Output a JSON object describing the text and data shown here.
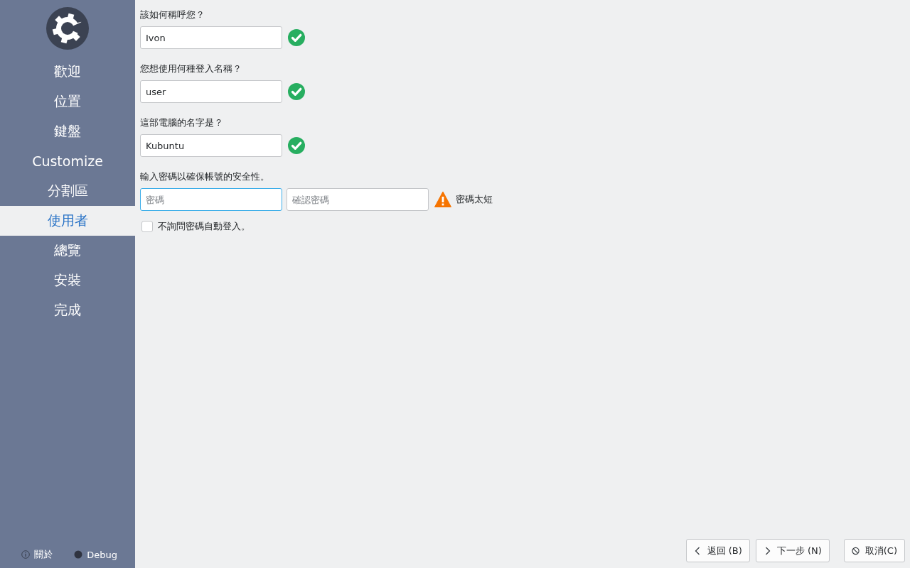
{
  "sidebar": {
    "items": [
      {
        "label": "歡迎",
        "selected": false
      },
      {
        "label": "位置",
        "selected": false
      },
      {
        "label": "鍵盤",
        "selected": false
      },
      {
        "label": "Customize",
        "selected": false
      },
      {
        "label": "分割區",
        "selected": false
      },
      {
        "label": "使用者",
        "selected": true
      },
      {
        "label": "總覽",
        "selected": false
      },
      {
        "label": "安裝",
        "selected": false
      },
      {
        "label": "完成",
        "selected": false
      }
    ],
    "footer": [
      {
        "label": "關於",
        "kind": "info"
      },
      {
        "label": "Debug",
        "kind": "dot"
      }
    ]
  },
  "fields": [
    {
      "label": "該如何稱呼您？",
      "value": "Ivon",
      "valid": true
    },
    {
      "label": "您想使用何種登入名稱？",
      "value": "user",
      "valid": true
    },
    {
      "label": "這部電腦的名字是？",
      "value": "Kubuntu",
      "valid": true
    }
  ],
  "password": {
    "label": "輸入密碼以確保帳號的安全性。",
    "inputs": [
      {
        "placeholder": "密碼",
        "focused": true
      },
      {
        "placeholder": "確認密碼",
        "focused": false
      }
    ],
    "valid": false,
    "message": "密碼太短"
  },
  "autologin": {
    "label": "不詢問密碼自動登入。",
    "checked": false
  },
  "buttons": [
    {
      "label": "返回 (B)",
      "kind": "back"
    },
    {
      "label": "下一步 (N)",
      "kind": "next"
    },
    {
      "label": "取消(C)",
      "kind": "cancel"
    }
  ]
}
